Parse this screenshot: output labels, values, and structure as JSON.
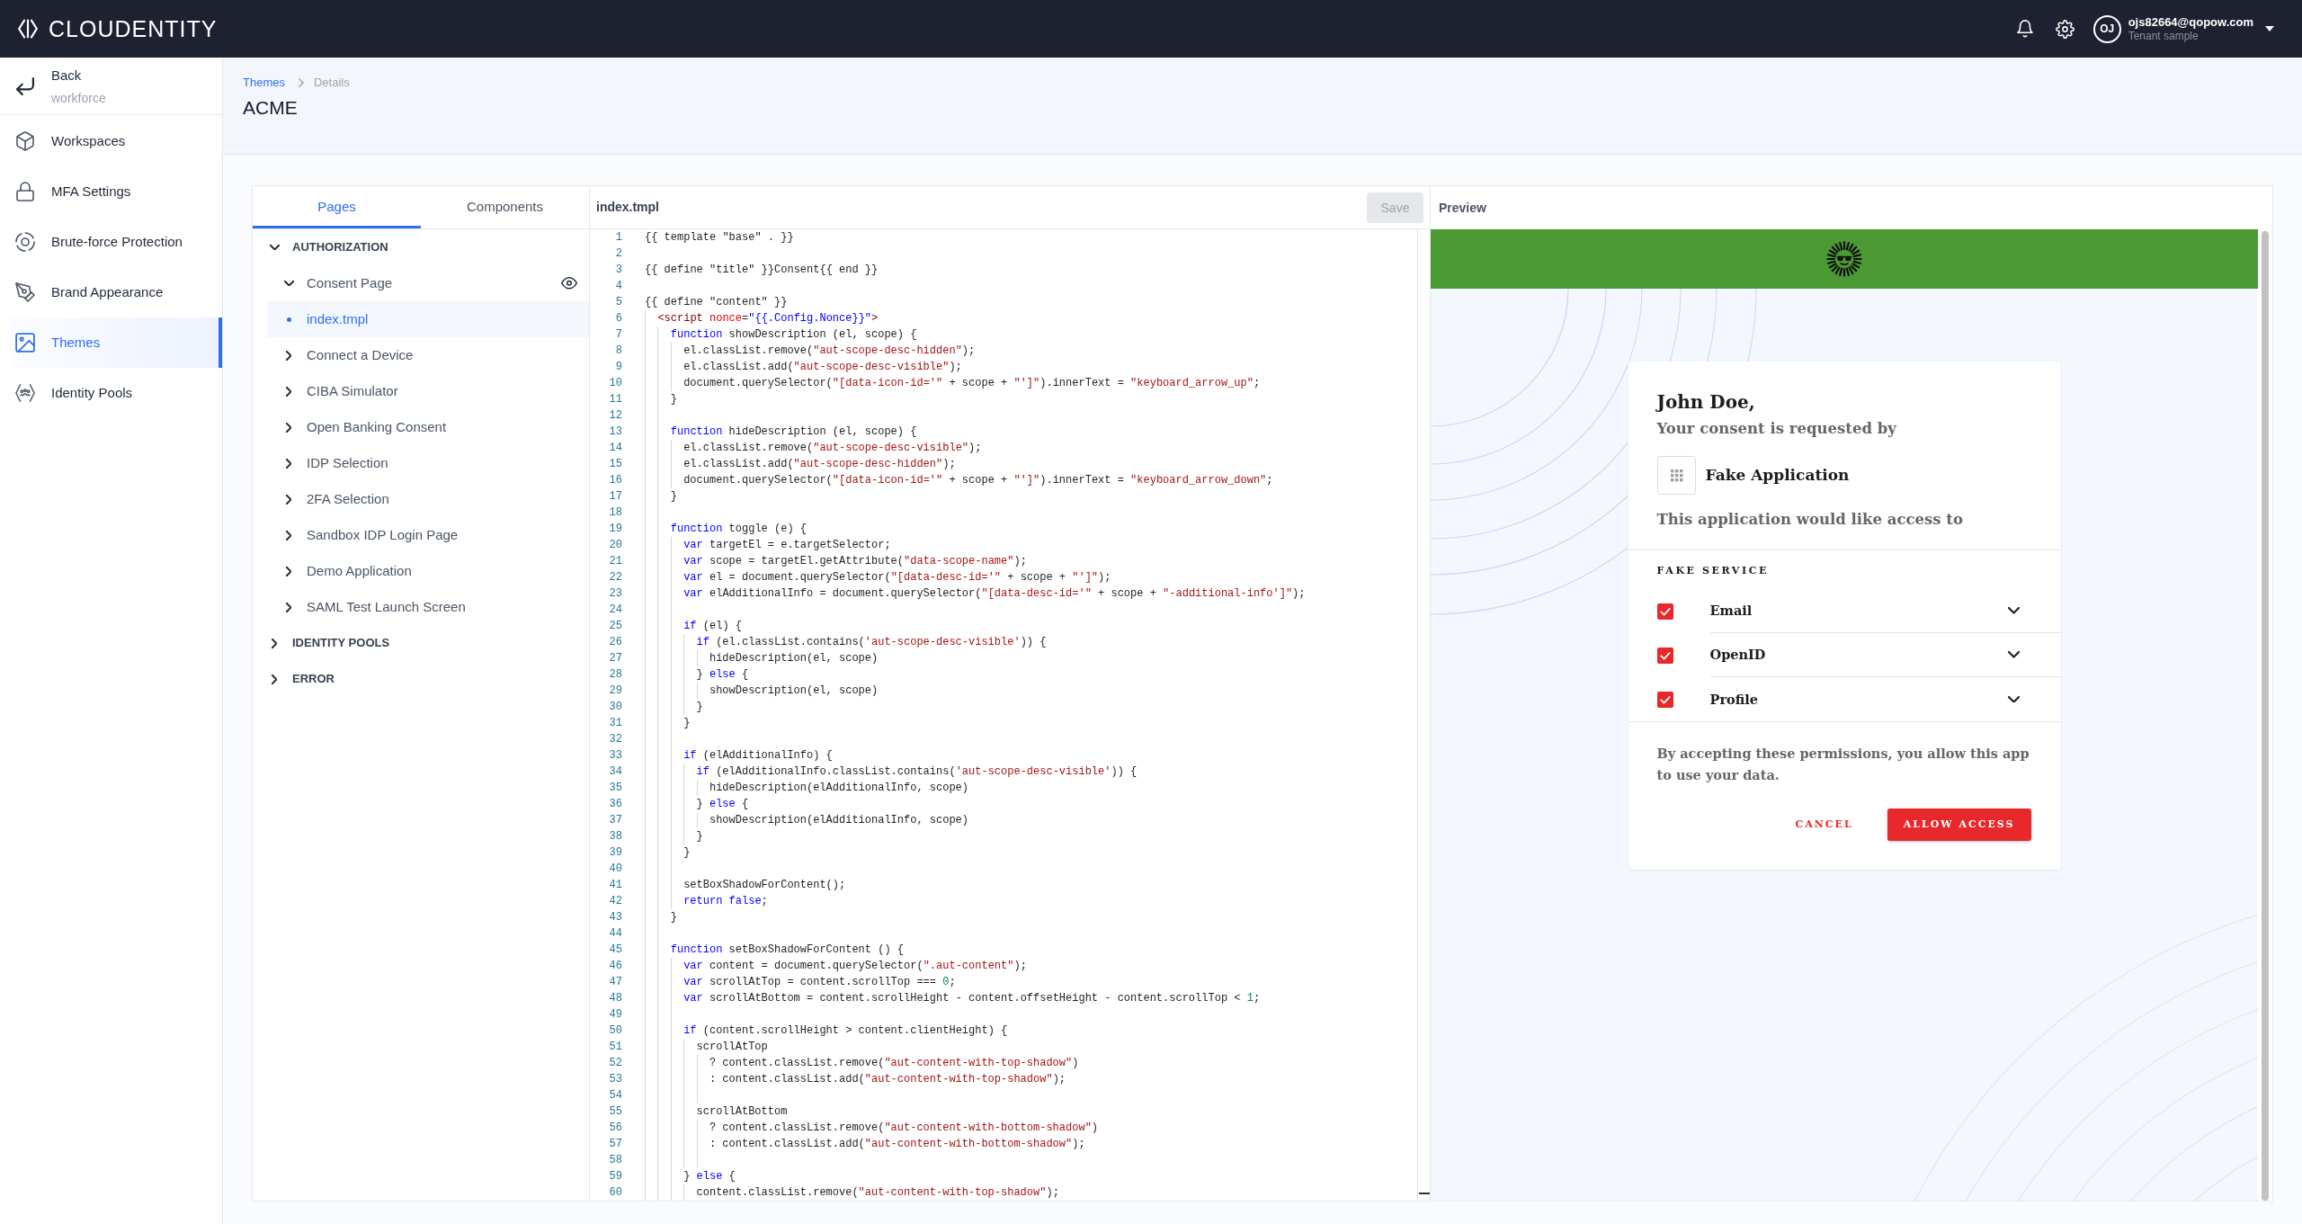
{
  "topbar": {
    "brand": "CLOUDENTITY",
    "user": {
      "initials": "OJ",
      "email": "ojs82664@qopow.com",
      "tenant": "Tenant sample"
    }
  },
  "sidebar": {
    "back": {
      "label": "Back",
      "subtitle": "workforce"
    },
    "items": [
      {
        "label": "Workspaces",
        "selected": false
      },
      {
        "label": "MFA Settings",
        "selected": false
      },
      {
        "label": "Brute-force Protection",
        "selected": false
      },
      {
        "label": "Brand Appearance",
        "selected": false
      },
      {
        "label": "Themes",
        "selected": true
      },
      {
        "label": "Identity Pools",
        "selected": false
      }
    ]
  },
  "header": {
    "breadcrumb": [
      "Themes",
      "Details"
    ],
    "title": "ACME"
  },
  "tabs": [
    {
      "label": "Pages",
      "selected": true
    },
    {
      "label": "Components",
      "selected": false
    }
  ],
  "tree": [
    {
      "label": "AUTHORIZATION",
      "kind": "group",
      "expanded": true,
      "selected": false,
      "children": [
        {
          "label": "Consent Page",
          "kind": "page",
          "expanded": true,
          "previewed": true,
          "selected": false,
          "children": [
            {
              "label": "index.tmpl",
              "kind": "file",
              "selected": true
            }
          ]
        },
        {
          "label": "Connect a Device",
          "kind": "page",
          "expanded": false,
          "previewed": false,
          "selected": false
        },
        {
          "label": "CIBA Simulator",
          "kind": "page",
          "expanded": false,
          "previewed": false,
          "selected": false
        },
        {
          "label": "Open Banking Consent",
          "kind": "page",
          "expanded": false,
          "previewed": false,
          "selected": false
        },
        {
          "label": "IDP Selection",
          "kind": "page",
          "expanded": false,
          "previewed": false,
          "selected": false
        },
        {
          "label": "2FA Selection",
          "kind": "page",
          "expanded": false,
          "previewed": false,
          "selected": false
        },
        {
          "label": "Sandbox IDP Login Page",
          "kind": "page",
          "expanded": false,
          "previewed": false,
          "selected": false
        },
        {
          "label": "Demo Application",
          "kind": "page",
          "expanded": false,
          "previewed": false,
          "selected": false
        },
        {
          "label": "SAML Test Launch Screen",
          "kind": "page",
          "expanded": false,
          "previewed": false,
          "selected": false
        }
      ]
    },
    {
      "label": "IDENTITY POOLS",
      "kind": "group",
      "expanded": false,
      "selected": false
    },
    {
      "label": "ERROR",
      "kind": "group",
      "expanded": false,
      "selected": false
    }
  ],
  "editor": {
    "file_name": "index.tmpl",
    "save_button": {
      "label": "Save",
      "disabled": true
    },
    "lines": [
      {
        "number": "1",
        "spans": [
          {
            "kind": "plain",
            "text": "{{ template \"base\" . }}"
          }
        ]
      },
      {
        "number": "2"
      },
      {
        "number": "3",
        "spans": [
          {
            "kind": "plain",
            "text": "{{ define \"title\" }}Consent{{ end }}"
          }
        ]
      },
      {
        "number": "4"
      },
      {
        "number": "5",
        "spans": [
          {
            "kind": "plain",
            "text": "{{ define \"content\" }}"
          }
        ]
      },
      {
        "number": "6",
        "spans": [
          {
            "kind": "tag",
            "text": "  <script"
          },
          {
            "kind": "attr",
            "text": " nonce"
          },
          {
            "kind": "plain",
            "text": "="
          },
          {
            "kind": "value",
            "text": "\"{{.Config.Nonce}}\""
          },
          {
            "kind": "tag",
            "text": ">"
          }
        ]
      },
      {
        "number": "7",
        "spans": [
          {
            "kind": "keyword",
            "text": "    function"
          },
          {
            "kind": "plain",
            "text": " showDescription (el, scope) {"
          }
        ]
      },
      {
        "number": "8",
        "spans": [
          {
            "kind": "plain",
            "text": "      el.classList.remove("
          },
          {
            "kind": "string",
            "text": "\"aut-scope-desc-hidden\""
          },
          {
            "kind": "plain",
            "text": ");"
          }
        ]
      },
      {
        "number": "9",
        "spans": [
          {
            "kind": "plain",
            "text": "      el.classList.add("
          },
          {
            "kind": "string",
            "text": "\"aut-scope-desc-visible\""
          },
          {
            "kind": "plain",
            "text": ");"
          }
        ]
      },
      {
        "number": "10",
        "spans": [
          {
            "kind": "plain",
            "text": "      document.querySelector("
          },
          {
            "kind": "string",
            "text": "\"[data-icon-id='\""
          },
          {
            "kind": "plain",
            "text": " + scope + "
          },
          {
            "kind": "string",
            "text": "\"']\""
          },
          {
            "kind": "plain",
            "text": ").innerText = "
          },
          {
            "kind": "string",
            "text": "\"keyboard_arrow_up\""
          },
          {
            "kind": "plain",
            "text": ";"
          }
        ]
      },
      {
        "number": "11",
        "spans": [
          {
            "kind": "plain",
            "text": "    }"
          }
        ]
      },
      {
        "number": "12"
      },
      {
        "number": "13",
        "spans": [
          {
            "kind": "keyword",
            "text": "    function"
          },
          {
            "kind": "plain",
            "text": " hideDescription (el, scope) {"
          }
        ]
      },
      {
        "number": "14",
        "spans": [
          {
            "kind": "plain",
            "text": "      el.classList.remove("
          },
          {
            "kind": "string",
            "text": "\"aut-scope-desc-visible\""
          },
          {
            "kind": "plain",
            "text": ");"
          }
        ]
      },
      {
        "number": "15",
        "spans": [
          {
            "kind": "plain",
            "text": "      el.classList.add("
          },
          {
            "kind": "string",
            "text": "\"aut-scope-desc-hidden\""
          },
          {
            "kind": "plain",
            "text": ");"
          }
        ]
      },
      {
        "number": "16",
        "spans": [
          {
            "kind": "plain",
            "text": "      document.querySelector("
          },
          {
            "kind": "string",
            "text": "\"[data-icon-id='\""
          },
          {
            "kind": "plain",
            "text": " + scope + "
          },
          {
            "kind": "string",
            "text": "\"']\""
          },
          {
            "kind": "plain",
            "text": ").innerText = "
          },
          {
            "kind": "string",
            "text": "\"keyboard_arrow_down\""
          },
          {
            "kind": "plain",
            "text": ";"
          }
        ]
      },
      {
        "number": "17",
        "spans": [
          {
            "kind": "plain",
            "text": "    }"
          }
        ]
      },
      {
        "number": "18"
      },
      {
        "number": "19",
        "spans": [
          {
            "kind": "keyword",
            "text": "    function"
          },
          {
            "kind": "plain",
            "text": " toggle (e) {"
          }
        ]
      },
      {
        "number": "20",
        "spans": [
          {
            "kind": "keyword",
            "text": "      var"
          },
          {
            "kind": "plain",
            "text": " targetEl = e.targetSelector;"
          }
        ]
      },
      {
        "number": "21",
        "spans": [
          {
            "kind": "keyword",
            "text": "      var"
          },
          {
            "kind": "plain",
            "text": " scope = targetEl.getAttribute("
          },
          {
            "kind": "string",
            "text": "\"data-scope-name\""
          },
          {
            "kind": "plain",
            "text": ");"
          }
        ]
      },
      {
        "number": "22",
        "spans": [
          {
            "kind": "keyword",
            "text": "      var"
          },
          {
            "kind": "plain",
            "text": " el = document.querySelector("
          },
          {
            "kind": "string",
            "text": "\"[data-desc-id='\""
          },
          {
            "kind": "plain",
            "text": " + scope + "
          },
          {
            "kind": "string",
            "text": "\"']\""
          },
          {
            "kind": "plain",
            "text": ");"
          }
        ]
      },
      {
        "number": "23",
        "spans": [
          {
            "kind": "keyword",
            "text": "      var"
          },
          {
            "kind": "plain",
            "text": " elAdditionalInfo = document.querySelector("
          },
          {
            "kind": "string",
            "text": "\"[data-desc-id='\""
          },
          {
            "kind": "plain",
            "text": " + scope + "
          },
          {
            "kind": "string",
            "text": "\"-additional-info']\""
          },
          {
            "kind": "plain",
            "text": ");"
          }
        ]
      },
      {
        "number": "24"
      },
      {
        "number": "25",
        "spans": [
          {
            "kind": "keyword",
            "text": "      if"
          },
          {
            "kind": "plain",
            "text": " (el) {"
          }
        ]
      },
      {
        "number": "26",
        "spans": [
          {
            "kind": "keyword",
            "text": "        if"
          },
          {
            "kind": "plain",
            "text": " (el.classList.contains("
          },
          {
            "kind": "string",
            "text": "'aut-scope-desc-visible'"
          },
          {
            "kind": "plain",
            "text": ")) {"
          }
        ]
      },
      {
        "number": "27",
        "spans": [
          {
            "kind": "plain",
            "text": "          hideDescription(el, scope)"
          }
        ]
      },
      {
        "number": "28",
        "spans": [
          {
            "kind": "plain",
            "text": "        } "
          },
          {
            "kind": "keyword",
            "text": "else"
          },
          {
            "kind": "plain",
            "text": " {"
          }
        ]
      },
      {
        "number": "29",
        "spans": [
          {
            "kind": "plain",
            "text": "          showDescription(el, scope)"
          }
        ]
      },
      {
        "number": "30",
        "spans": [
          {
            "kind": "plain",
            "text": "        }"
          }
        ]
      },
      {
        "number": "31",
        "spans": [
          {
            "kind": "plain",
            "text": "      }"
          }
        ]
      },
      {
        "number": "32"
      },
      {
        "number": "33",
        "spans": [
          {
            "kind": "keyword",
            "text": "      if"
          },
          {
            "kind": "plain",
            "text": " (elAdditionalInfo) {"
          }
        ]
      },
      {
        "number": "34",
        "spans": [
          {
            "kind": "keyword",
            "text": "        if"
          },
          {
            "kind": "plain",
            "text": " (elAdditionalInfo.classList.contains("
          },
          {
            "kind": "string",
            "text": "'aut-scope-desc-visible'"
          },
          {
            "kind": "plain",
            "text": ")) {"
          }
        ]
      },
      {
        "number": "35",
        "spans": [
          {
            "kind": "plain",
            "text": "          hideDescription(elAdditionalInfo, scope)"
          }
        ]
      },
      {
        "number": "36",
        "spans": [
          {
            "kind": "plain",
            "text": "        } "
          },
          {
            "kind": "keyword",
            "text": "else"
          },
          {
            "kind": "plain",
            "text": " {"
          }
        ]
      },
      {
        "number": "37",
        "spans": [
          {
            "kind": "plain",
            "text": "          showDescription(elAdditionalInfo, scope)"
          }
        ]
      },
      {
        "number": "38",
        "spans": [
          {
            "kind": "plain",
            "text": "        }"
          }
        ]
      },
      {
        "number": "39",
        "spans": [
          {
            "kind": "plain",
            "text": "      }"
          }
        ]
      },
      {
        "number": "40"
      },
      {
        "number": "41",
        "spans": [
          {
            "kind": "plain",
            "text": "      setBoxShadowForContent();"
          }
        ]
      },
      {
        "number": "42",
        "spans": [
          {
            "kind": "keyword",
            "text": "      return false"
          },
          {
            "kind": "plain",
            "text": ";"
          }
        ]
      },
      {
        "number": "43",
        "spans": [
          {
            "kind": "plain",
            "text": "    }"
          }
        ]
      },
      {
        "number": "44"
      },
      {
        "number": "45",
        "spans": [
          {
            "kind": "keyword",
            "text": "    function"
          },
          {
            "kind": "plain",
            "text": " setBoxShadowForContent () {"
          }
        ]
      },
      {
        "number": "46",
        "spans": [
          {
            "kind": "keyword",
            "text": "      var"
          },
          {
            "kind": "plain",
            "text": " content = document.querySelector("
          },
          {
            "kind": "string",
            "text": "\".aut-content\""
          },
          {
            "kind": "plain",
            "text": ");"
          }
        ]
      },
      {
        "number": "47",
        "spans": [
          {
            "kind": "keyword",
            "text": "      var"
          },
          {
            "kind": "plain",
            "text": " scrollAtTop = content.scrollTop === "
          },
          {
            "kind": "number",
            "text": "0"
          },
          {
            "kind": "plain",
            "text": ";"
          }
        ]
      },
      {
        "number": "48",
        "spans": [
          {
            "kind": "keyword",
            "text": "      var"
          },
          {
            "kind": "plain",
            "text": " scrollAtBottom = content.scrollHeight - content.offsetHeight - content.scrollTop < "
          },
          {
            "kind": "number",
            "text": "1"
          },
          {
            "kind": "plain",
            "text": ";"
          }
        ]
      },
      {
        "number": "49"
      },
      {
        "number": "50",
        "spans": [
          {
            "kind": "keyword",
            "text": "      if"
          },
          {
            "kind": "plain",
            "text": " (content.scrollHeight > content.clientHeight) {"
          }
        ]
      },
      {
        "number": "51",
        "spans": [
          {
            "kind": "plain",
            "text": "        scrollAtTop"
          }
        ]
      },
      {
        "number": "52",
        "spans": [
          {
            "kind": "plain",
            "text": "          ? content.classList.remove("
          },
          {
            "kind": "string",
            "text": "\"aut-content-with-top-shadow\""
          },
          {
            "kind": "plain",
            "text": ")"
          }
        ]
      },
      {
        "number": "53",
        "spans": [
          {
            "kind": "plain",
            "text": "          : content.classList.add("
          },
          {
            "kind": "string",
            "text": "\"aut-content-with-top-shadow\""
          },
          {
            "kind": "plain",
            "text": ");"
          }
        ]
      },
      {
        "number": "54"
      },
      {
        "number": "55",
        "spans": [
          {
            "kind": "plain",
            "text": "        scrollAtBottom"
          }
        ]
      },
      {
        "number": "56",
        "spans": [
          {
            "kind": "plain",
            "text": "          ? content.classList.remove("
          },
          {
            "kind": "string",
            "text": "\"aut-content-with-bottom-shadow\""
          },
          {
            "kind": "plain",
            "text": ")"
          }
        ]
      },
      {
        "number": "57",
        "spans": [
          {
            "kind": "plain",
            "text": "          : content.classList.add("
          },
          {
            "kind": "string",
            "text": "\"aut-content-with-bottom-shadow\""
          },
          {
            "kind": "plain",
            "text": ");"
          }
        ]
      },
      {
        "number": "58"
      },
      {
        "number": "59",
        "spans": [
          {
            "kind": "plain",
            "text": "      } "
          },
          {
            "kind": "keyword",
            "text": "else"
          },
          {
            "kind": "plain",
            "text": " {"
          }
        ]
      },
      {
        "number": "60",
        "spans": [
          {
            "kind": "plain",
            "text": "        content.classList.remove("
          },
          {
            "kind": "string",
            "text": "\"aut-content-with-top-shadow\""
          },
          {
            "kind": "plain",
            "text": ");"
          }
        ]
      }
    ]
  },
  "preview": {
    "title": "Preview",
    "greeting": "John Doe,",
    "subtitle": "Your consent is requested by",
    "application": "Fake Application",
    "access_text": "This application would like access to",
    "service": "FAKE SERVICE",
    "scopes": [
      {
        "label": "Email",
        "checked": true,
        "expanded": false
      },
      {
        "label": "OpenID",
        "checked": true,
        "expanded": false
      },
      {
        "label": "Profile",
        "checked": true,
        "expanded": false
      }
    ],
    "notice": "By accepting these permissions, you allow this app to use your data.",
    "buttons": [
      {
        "label": "CANCEL",
        "kind": "text"
      },
      {
        "label": "ALLOW ACCESS",
        "kind": "primary"
      }
    ]
  }
}
